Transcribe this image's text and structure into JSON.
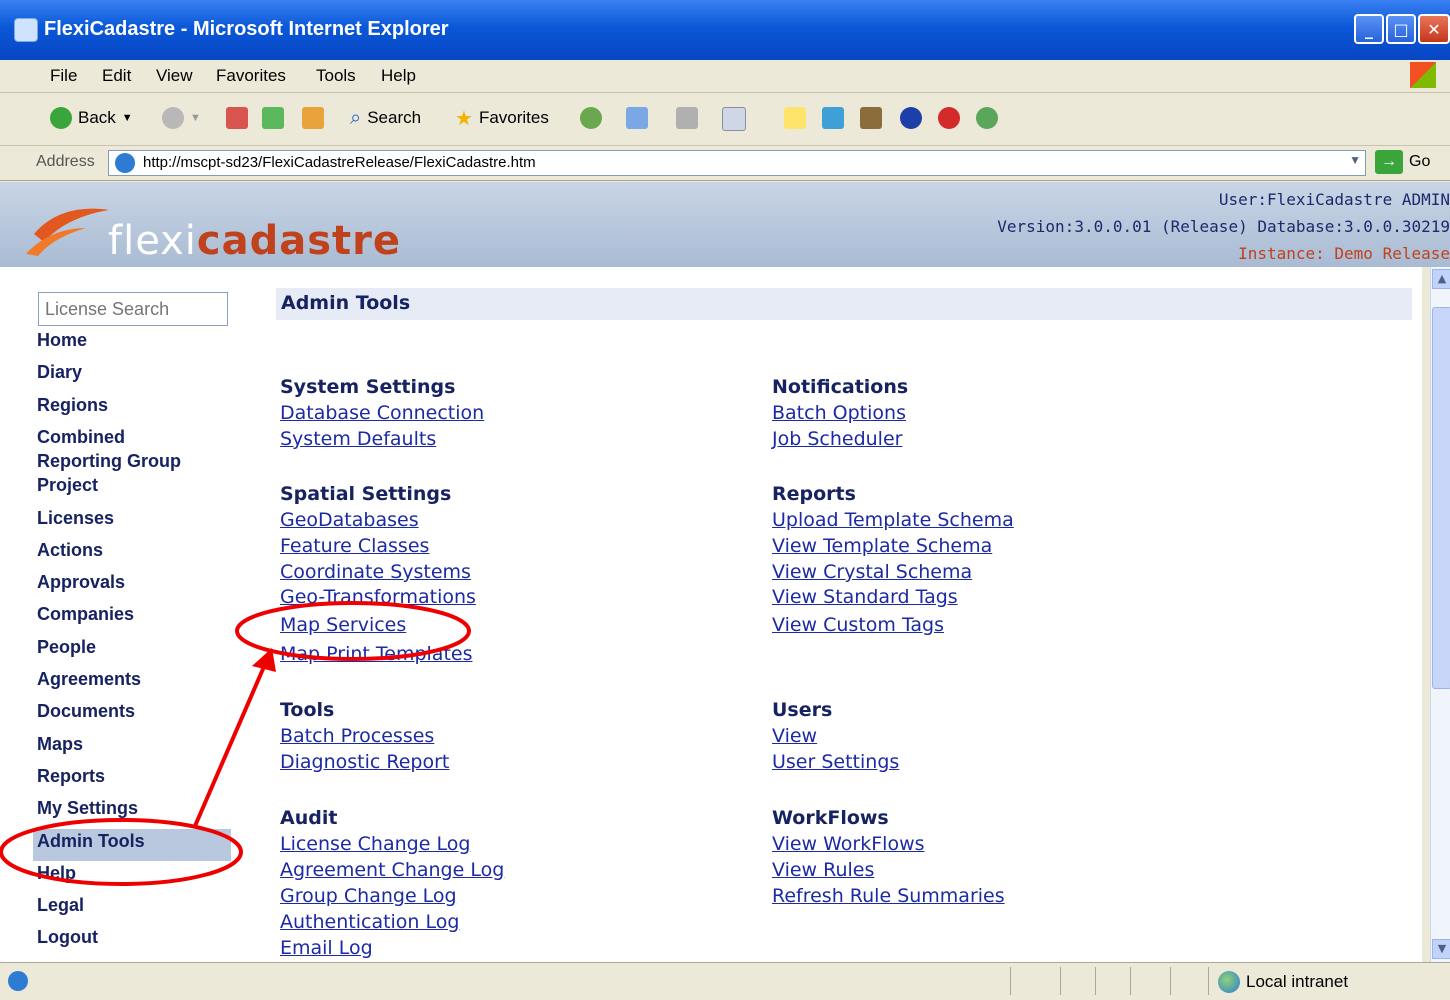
{
  "window": {
    "title": "FlexiCadastre - Microsoft Internet Explorer"
  },
  "menu": [
    "File",
    "Edit",
    "View",
    "Favorites",
    "Tools",
    "Help"
  ],
  "toolbar": {
    "back": "Back",
    "search": "Search",
    "favorites": "Favorites"
  },
  "address": {
    "label": "Address",
    "url": "http://mscpt-sd23/FlexiCadastreRelease/FlexiCadastre.htm",
    "go": "Go"
  },
  "header": {
    "logo_light": "flexi",
    "logo_bold": "cadastre",
    "user": "User:FlexiCadastre ADMIN",
    "version": "Version:3.0.0.01 (Release) Database:3.0.0.30219",
    "instance": "Instance: Demo Release"
  },
  "sidebar": {
    "search_placeholder": "License Search",
    "items": [
      "Home",
      "Diary",
      "Regions",
      "Combined",
      "Reporting Group",
      "Project",
      "Licenses",
      "Actions",
      "Approvals",
      "Companies",
      "People",
      "Agreements",
      "Documents",
      "Maps",
      "Reports",
      "My Settings",
      "Admin Tools",
      "Help",
      "Legal",
      "Logout"
    ],
    "selected": "Admin Tools"
  },
  "page": {
    "title": "Admin Tools",
    "sections": {
      "system_settings": {
        "title": "System Settings",
        "links": [
          "Database Connection",
          "System Defaults"
        ]
      },
      "spatial_settings": {
        "title": "Spatial Settings",
        "links": [
          "GeoDatabases",
          "Feature Classes",
          "Coordinate Systems",
          "Geo-Transformations",
          "Map Services",
          "Map Print Templates"
        ]
      },
      "tools": {
        "title": "Tools",
        "links": [
          "Batch Processes",
          "Diagnostic Report"
        ]
      },
      "audit": {
        "title": "Audit",
        "links": [
          "License Change Log",
          "Agreement Change Log",
          "Group Change Log",
          "Authentication Log",
          "Email Log"
        ]
      },
      "notifications": {
        "title": "Notifications",
        "links": [
          "Batch Options",
          "Job Scheduler"
        ]
      },
      "reports": {
        "title": "Reports",
        "links": [
          "Upload Template Schema",
          "View Template Schema",
          "View Crystal Schema",
          "View Standard Tags",
          "View Custom Tags"
        ]
      },
      "users": {
        "title": "Users",
        "links": [
          "View",
          "User Settings"
        ]
      },
      "workflows": {
        "title": "WorkFlows",
        "links": [
          "View WorkFlows",
          "View Rules",
          "Refresh Rule Summaries"
        ]
      }
    }
  },
  "status": {
    "zone": "Local intranet"
  },
  "colors": {
    "annotation": "#ee0000",
    "link": "#1c2aa3",
    "nav": "#172361"
  }
}
